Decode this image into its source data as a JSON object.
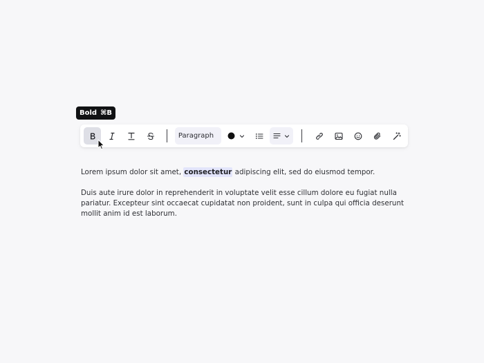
{
  "tooltip": {
    "label": "Bold",
    "shortcut": "⌘B"
  },
  "toolbar": {
    "bold": {
      "icon": "bold-icon",
      "active": true
    },
    "italic": {
      "icon": "italic-icon"
    },
    "underline": {
      "icon": "text-underline-icon"
    },
    "strikethrough": {
      "icon": "strikethrough-icon"
    },
    "block_type": {
      "selected": "Paragraph"
    },
    "text_color": {
      "icon": "color-swatch-icon",
      "color": "#111111"
    },
    "bullet_list": {
      "icon": "bullet-list-icon"
    },
    "align": {
      "icon": "align-left-icon"
    },
    "link": {
      "icon": "link-icon"
    },
    "image": {
      "icon": "image-icon"
    },
    "emoji": {
      "icon": "emoji-icon"
    },
    "attachment": {
      "icon": "paperclip-icon"
    },
    "ai_magic": {
      "icon": "magic-wand-icon"
    }
  },
  "editor": {
    "p1_before": "Lorem ipsum dolor sit amet, ",
    "p1_selected": "consectetur",
    "p1_after": " adipiscing elit, sed do eiusmod tempor.",
    "p2": "Duis aute irure dolor in reprehenderit in voluptate velit esse cillum dolore eu fugiat nulla pariatur. Excepteur sint occaecat cupidatat non proident, sunt in culpa qui officia deserunt mollit anim id est laborum."
  },
  "colors": {
    "background": "#f7f7f9",
    "toolbar": "#ffffff",
    "active_button": "#dedfe6",
    "selection": "#e3e5fb",
    "tooltip": "#111214"
  }
}
